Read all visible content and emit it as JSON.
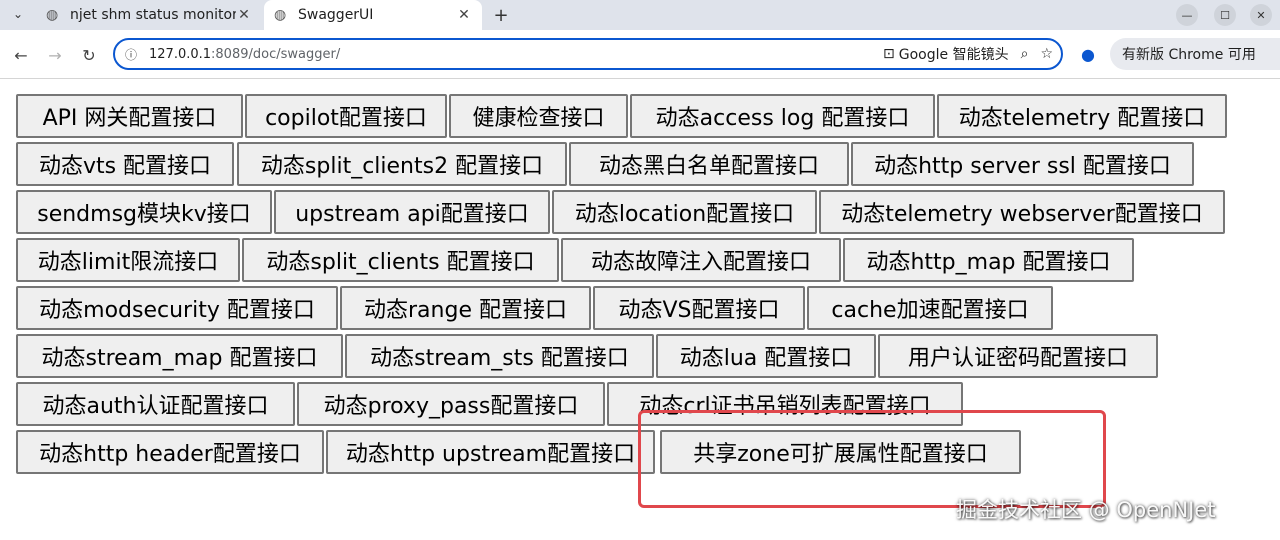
{
  "browser": {
    "tabs": [
      {
        "title": "njet shm status monitor",
        "active": false
      },
      {
        "title": "SwaggerUI",
        "active": true
      }
    ],
    "new_tab": "+",
    "url": {
      "host": "127.0.0.1",
      "rest": ":8089/doc/swagger/"
    },
    "lens_label": "Google 智能镜头",
    "update_label": "有新版 Chrome 可用"
  },
  "buttons": [
    "API 网关配置接口",
    "copilot配置接口",
    "健康检查接口",
    "动态access log 配置接口",
    "动态telemetry 配置接口",
    "动态vts 配置接口",
    "动态split_clients2 配置接口",
    "动态黑白名单配置接口",
    "动态http server ssl 配置接口",
    "sendmsg模块kv接口",
    "upstream api配置接口",
    "动态location配置接口",
    "动态telemetry webserver配置接口",
    "动态limit限流接口",
    "动态split_clients 配置接口",
    "动态故障注入配置接口",
    "动态http_map 配置接口",
    "动态modsecurity 配置接口",
    "动态range 配置接口",
    "动态VS配置接口",
    "cache加速配置接口",
    "动态stream_map 配置接口",
    "动态stream_sts 配置接口",
    "动态lua 配置接口",
    "用户认证密码配置接口",
    "动态auth认证配置接口",
    "动态proxy_pass配置接口",
    "动态crl证书吊销列表配置接口",
    "动态http header配置接口",
    "动态http upstream配置接口",
    "共享zone可扩展属性配置接口"
  ],
  "watermark": "掘金技术社区 @ OpenNJet",
  "colors": {
    "highlight": "#e0474c",
    "accent": "#0b57d0"
  }
}
